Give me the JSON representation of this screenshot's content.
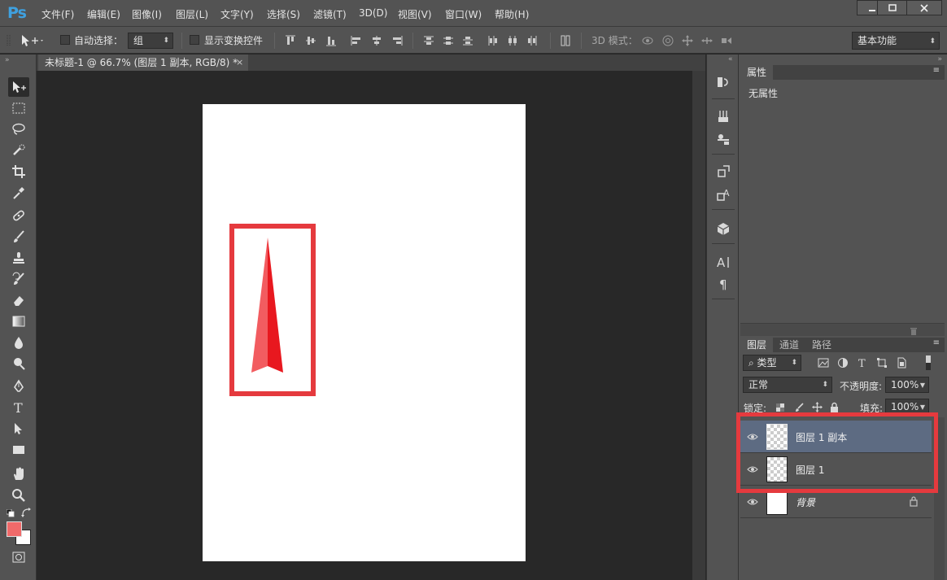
{
  "app": {
    "logo": "Ps",
    "menu": [
      "文件(F)",
      "编辑(E)",
      "图像(I)",
      "图层(L)",
      "文字(Y)",
      "选择(S)",
      "滤镜(T)",
      "3D(D)",
      "视图(V)",
      "窗口(W)",
      "帮助(H)"
    ]
  },
  "options": {
    "auto_select_label": "自动选择：",
    "auto_select_value": "组",
    "show_transform_label": "显示变换控件",
    "mode_3d_label": "3D 模式：",
    "workspace": "基本功能"
  },
  "document": {
    "tab_title": "未标题-1 @ 66.7% (图层 1 副本, RGB/8) *",
    "close_glyph": "×"
  },
  "colors": {
    "foreground": "#f06a6a",
    "background": "#ffffff",
    "highlight": "#e53a3e",
    "arrow_light": "#f25c60",
    "arrow_dark": "#e8181f"
  },
  "properties": {
    "tab": "属性",
    "body": "无属性"
  },
  "layers_panel": {
    "tabs": [
      "图层",
      "通道",
      "路径"
    ],
    "filter_kind": "类型",
    "blend_mode": "正常",
    "opacity_label": "不透明度:",
    "opacity_value": "100%",
    "lock_label": "锁定:",
    "fill_label": "填充:",
    "fill_value": "100%",
    "layers": [
      {
        "name": "图层 1 副本",
        "selected": true,
        "visible": true
      },
      {
        "name": "图层 1",
        "selected": false,
        "visible": true
      },
      {
        "name": "背景",
        "selected": false,
        "visible": true,
        "locked": true
      }
    ]
  }
}
